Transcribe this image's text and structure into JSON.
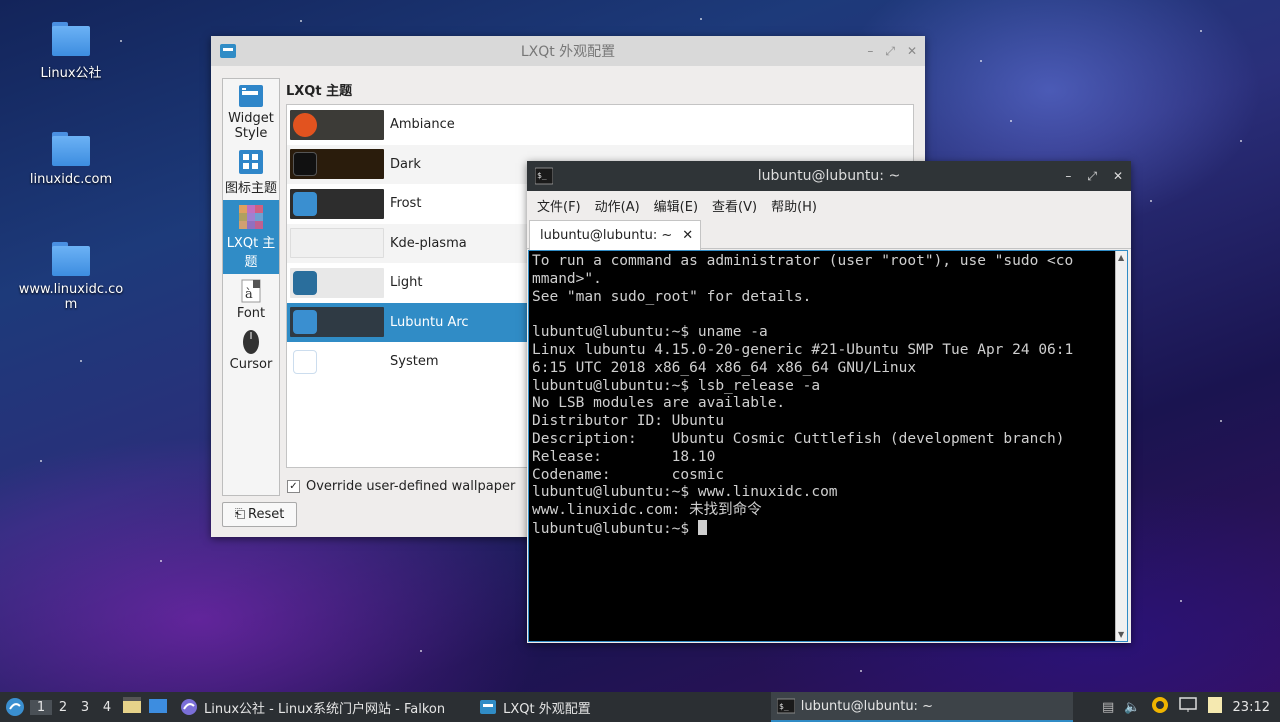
{
  "desktop": {
    "icons": [
      {
        "label": "Linux公社"
      },
      {
        "label": "linuxidc.com"
      },
      {
        "label": "www.linuxidc.co\nm"
      }
    ]
  },
  "appearance": {
    "title": "LXQt 外观配置",
    "sidebar": [
      {
        "label": "Widget Style",
        "icon": "widget-style-icon"
      },
      {
        "label": "图标主题",
        "icon": "icon-theme-icon"
      },
      {
        "label": "LXQt 主题",
        "icon": "lxqt-theme-icon"
      },
      {
        "label": "Font",
        "icon": "font-icon"
      },
      {
        "label": "Cursor",
        "icon": "cursor-icon"
      }
    ],
    "section_title": "LXQt 主题",
    "themes": [
      {
        "name": "Ambiance",
        "preview_color": "#3c3b37",
        "logo_color": "#e2531f"
      },
      {
        "name": "Dark",
        "preview_color": "#2a1c0c",
        "logo_color": "#1a1a1a"
      },
      {
        "name": "Frost",
        "preview_color": "#2d2d2d",
        "logo_color": "#3a8fd0"
      },
      {
        "name": "Kde-plasma",
        "preview_color": "#f0f0f0",
        "logo_color": "#f0f0f0"
      },
      {
        "name": "Light",
        "preview_color": "#e8e8e8",
        "logo_color": "#2a6e9c"
      },
      {
        "name": "Lubuntu Arc",
        "preview_color": "#2f3a44",
        "logo_color": "#3a8fd0"
      },
      {
        "name": "System",
        "preview_color": "#ffffff",
        "logo_color": "#ffffff"
      }
    ],
    "selected_theme": "Lubuntu Arc",
    "override_label": "Override user-defined wallpaper",
    "override_checked": true,
    "reset_label": "Reset"
  },
  "terminal": {
    "title": "lubuntu@lubuntu: ~",
    "menu": [
      "文件(F)",
      "动作(A)",
      "编辑(E)",
      "查看(V)",
      "帮助(H)"
    ],
    "tab_label": "lubuntu@lubuntu: ~",
    "lines": [
      "To run a command as administrator (user \"root\"), use \"sudo <co",
      "mmand>\".",
      "See \"man sudo_root\" for details.",
      "",
      "lubuntu@lubuntu:~$ uname -a",
      "Linux lubuntu 4.15.0-20-generic #21-Ubuntu SMP Tue Apr 24 06:1",
      "6:15 UTC 2018 x86_64 x86_64 x86_64 GNU/Linux",
      "lubuntu@lubuntu:~$ lsb_release -a",
      "No LSB modules are available.",
      "Distributor ID: Ubuntu",
      "Description:    Ubuntu Cosmic Cuttlefish (development branch)",
      "Release:        18.10",
      "Codename:       cosmic",
      "lubuntu@lubuntu:~$ www.linuxidc.com",
      "www.linuxidc.com: 未找到命令"
    ],
    "prompt": "lubuntu@lubuntu:~$ "
  },
  "taskbar": {
    "workspaces": [
      "1",
      "2",
      "3",
      "4"
    ],
    "active_workspace": "1",
    "tasks": [
      {
        "label": "Linux公社 - Linux系统门户网站 - Falkon",
        "icon": "falkon-icon"
      },
      {
        "label": "LXQt 外观配置",
        "icon": "settings-icon"
      },
      {
        "label": "lubuntu@lubuntu: ~",
        "icon": "terminal-icon"
      }
    ],
    "clock": "23:12"
  }
}
